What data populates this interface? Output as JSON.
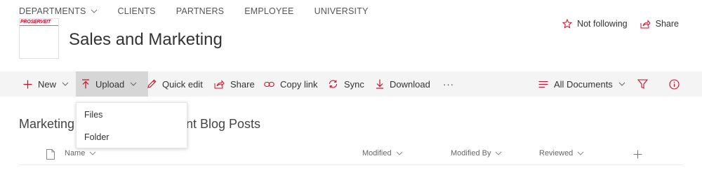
{
  "topnav": {
    "items": [
      "DEPARTMENTS",
      "CLIENTS",
      "PARTNERS",
      "EMPLOYEE",
      "UNIVERSITY"
    ]
  },
  "site": {
    "logo_text": "PROSERVEIT",
    "title": "Sales and Marketing"
  },
  "header_actions": {
    "follow_label": "Not following",
    "share_label": "Share"
  },
  "commandbar": {
    "new_label": "New",
    "upload_label": "Upload",
    "quick_edit_label": "Quick edit",
    "share_label": "Share",
    "copy_link_label": "Copy link",
    "sync_label": "Sync",
    "download_label": "Download",
    "more_label": "···",
    "view_label": "All Documents"
  },
  "upload_menu": {
    "items": [
      "Files",
      "Folder"
    ]
  },
  "list": {
    "title_prefix": "Marketing",
    "title_suffix": "nt Blog Posts"
  },
  "columns": {
    "name": "Name",
    "modified": "Modified",
    "modified_by": "Modified By",
    "reviewed": "Reviewed"
  },
  "colors": {
    "accent_red": "#c8102e",
    "commandbar_bg": "#f4f4f4",
    "active_button_bg": "#d6d6d6"
  }
}
